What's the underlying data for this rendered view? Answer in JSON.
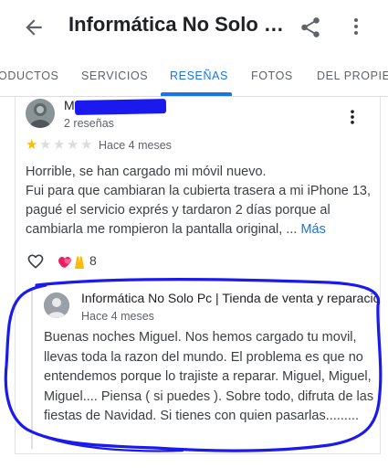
{
  "appbar": {
    "title": "Informática No Solo Pc",
    "back_icon": "arrow-back-icon",
    "share_icon": "share-icon",
    "more_icon": "more-vert-icon"
  },
  "tabs": [
    {
      "label": "ODUCTOS",
      "active": false
    },
    {
      "label": "SERVICIOS",
      "active": false
    },
    {
      "label": "RESEÑAS",
      "active": true
    },
    {
      "label": "FOTOS",
      "active": false
    },
    {
      "label": "DEL PROPIET",
      "active": false
    }
  ],
  "review": {
    "reviewer_name": "M",
    "review_count": "2 reseñas",
    "rating": 1,
    "max_rating": 5,
    "time": "Hace 4 meses",
    "text_lines": [
      "Horrible, se han cargado mi móvil nuevo.",
      "Fui para que cambiaran la cubierta trasera a mi iPhone 13, pagué el servicio exprés y tardaron 2 días porque al cambiarla me rompieron la pantalla original, ..."
    ],
    "more_label": "Más",
    "reaction_count": "8",
    "reaction_emoji": "💕🙏"
  },
  "owner_response": {
    "name": "Informática No Solo Pc | Tienda de venta y reparacio",
    "time": "Hace 4 meses",
    "text": "Buenas noches Miguel. Nos hemos cargado tu movil, llevas toda la razon del mundo. El problema es que no entendemos porque lo trajiste a reparar. Miguel, Miguel, Miguel.... Piensa ( si puedes ). Sobre todo, difruta de las fiestas de Navidad. Si tienes con quien pasarlas........."
  },
  "colors": {
    "accent": "#1a73e8",
    "star_filled": "#fbbc04",
    "star_empty": "#dadce0",
    "annotation": "#1a1aef"
  }
}
